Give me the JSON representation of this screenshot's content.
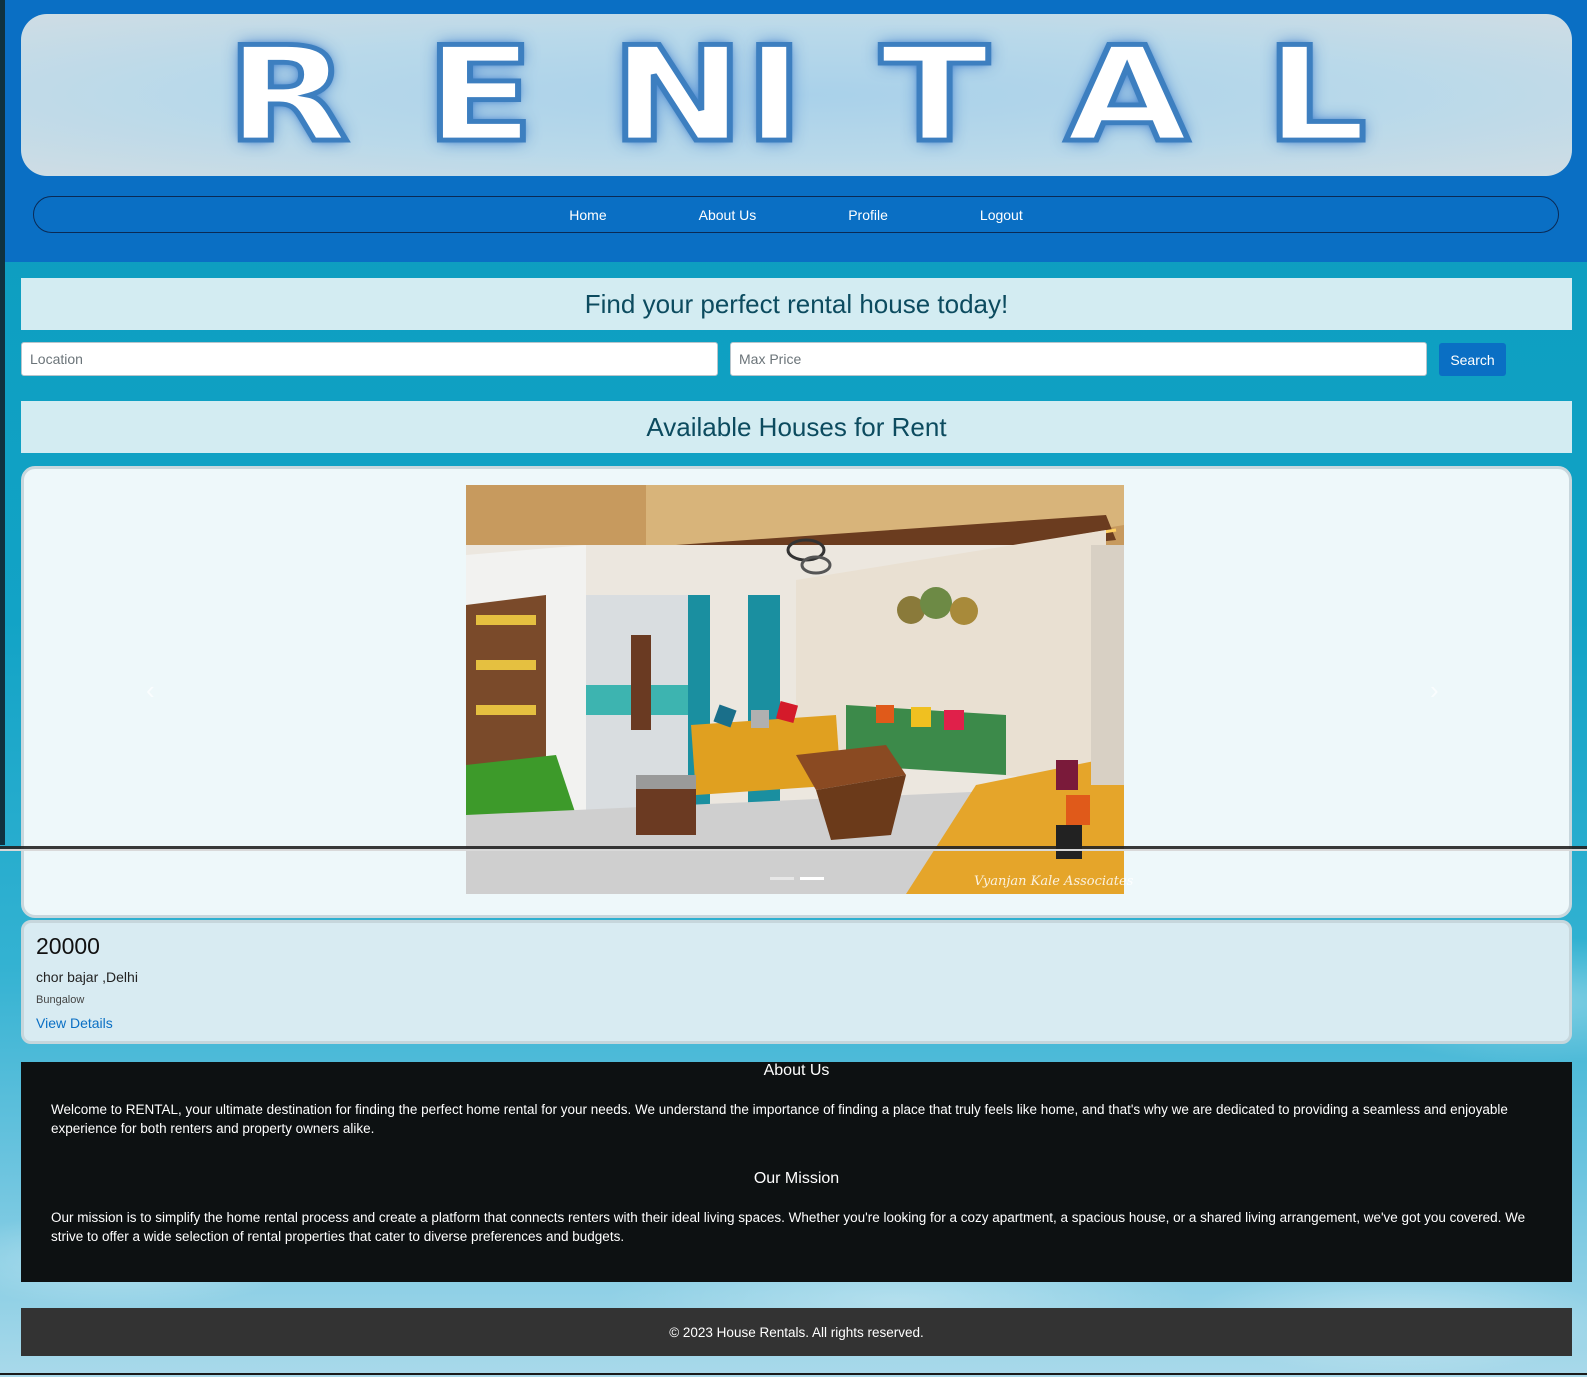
{
  "brand": {
    "logo_text": "RENTAL",
    "letters": [
      "R",
      "E",
      "N",
      "I",
      "T",
      "A",
      "L"
    ]
  },
  "nav": {
    "items": [
      {
        "label": "Home"
      },
      {
        "label": "About Us"
      },
      {
        "label": "Profile"
      },
      {
        "label": "Logout"
      }
    ]
  },
  "search": {
    "heading": "Find your perfect rental house today!",
    "location_placeholder": "Location",
    "max_price_placeholder": "Max Price",
    "button_label": "Search"
  },
  "listings": {
    "heading": "Available Houses for Rent",
    "carousel": {
      "image_caption": "Vyanjan Kale Associates",
      "prev_icon": "chevron-left-icon",
      "next_icon": "chevron-right-icon",
      "slide_count": 2,
      "active_slide": 2
    },
    "items": [
      {
        "price": "20000",
        "address": "chor bajar ,Delhi",
        "type": "Bungalow",
        "link_label": "View Details"
      }
    ]
  },
  "about": {
    "title": "About Us",
    "intro": "Welcome to RENTAL, your ultimate destination for finding the perfect home rental for your needs. We understand the importance of finding a place that truly feels like home, and that's why we are dedicated to providing a seamless and enjoyable experience for both renters and property owners alike.",
    "mission_title": "Our Mission",
    "mission": "Our mission is to simplify the home rental process and create a platform that connects renters with their ideal living spaces. Whether you're looking for a cozy apartment, a spacious house, or a shared living arrangement, we've got you covered. We strive to offer a wide selection of rental properties that cater to diverse preferences and budgets."
  },
  "footer": {
    "copyright": "© 2023 House Rentals. All rights reserved."
  },
  "colors": {
    "header_bg": "#0a6fc4",
    "accent": "#0a6fc4",
    "page_bg": "#12a3c6",
    "about_bg": "#0d1112",
    "footer_bg": "#333333"
  }
}
